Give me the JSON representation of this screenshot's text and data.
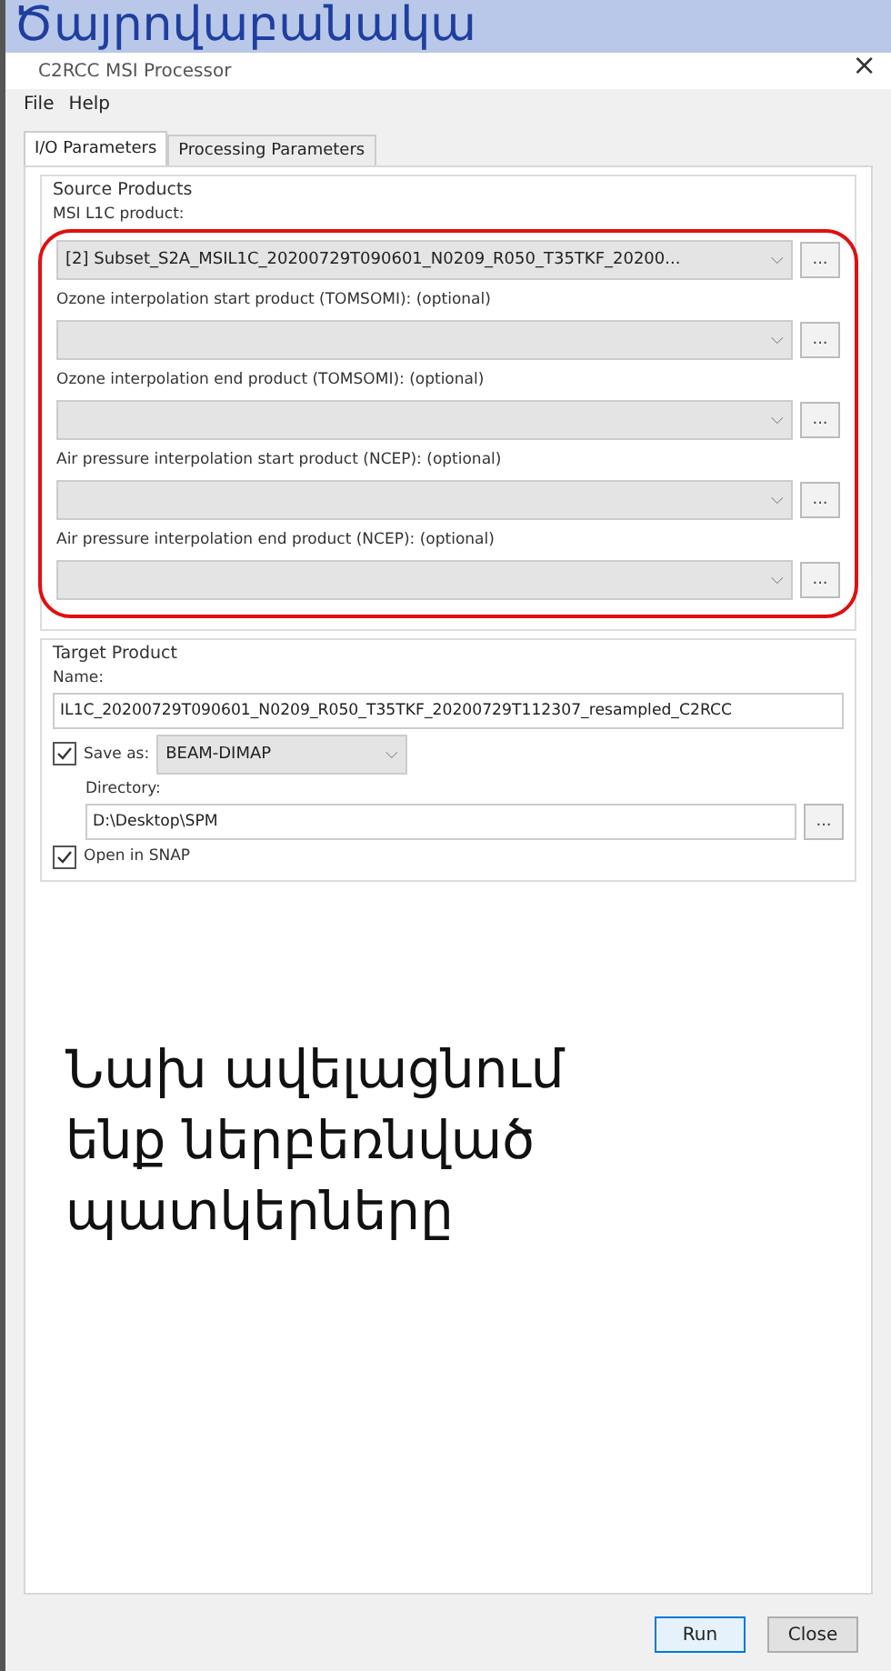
{
  "slide_title": "Ծայրովաբանակա",
  "window": {
    "title": "C2RCC MSI Processor",
    "close": "×"
  },
  "menu": [
    "File",
    "Help"
  ],
  "tabs": [
    {
      "label": "I/O Parameters",
      "selected": true
    },
    {
      "label": "Processing Parameters",
      "selected": false
    }
  ],
  "source_products": {
    "title": "Source Products",
    "first_label": "MSI L1C product:",
    "fields": [
      {
        "value": "[2] Subset_S2A_MSIL1C_20200729T090601_N0209_R050_T35TKF_20200...",
        "caret": "⌵",
        "browse": "..."
      },
      {
        "label": "Ozone interpolation start product (TOMSOMI): (optional)",
        "caret": "⌵",
        "browse": "..."
      },
      {
        "label": "Ozone interpolation end product (TOMSOMI): (optional)",
        "caret": "⌵",
        "browse": "..."
      },
      {
        "label": "Air pressure interpolation start product (NCEP): (optional)",
        "caret": "⌵",
        "browse": "..."
      },
      {
        "label": "Air pressure interpolation end product (NCEP): (optional)",
        "caret": "⌵",
        "browse": "..."
      }
    ]
  },
  "target_product": {
    "title": "Target Product",
    "name_label": "Name:",
    "name": "IL1C_20200729T090601_N0209_R050_T35TKF_20200729T112307_resampled_C2RCC",
    "save_as": {
      "label": "Save as:",
      "checked": true,
      "format": "BEAM-DIMAP",
      "caret": "⌵"
    },
    "directory_label": "Directory:",
    "directory": "D:\\Desktop\\SPM",
    "browse": "...",
    "open_in_snap": {
      "label": "Open in SNAP",
      "checked": true
    }
  },
  "annotation": "Նախ ավելացնում ենք ներբեռնված պատկերները",
  "buttons": [
    {
      "label": "Run",
      "default": true
    },
    {
      "label": "Close",
      "default": false
    }
  ]
}
